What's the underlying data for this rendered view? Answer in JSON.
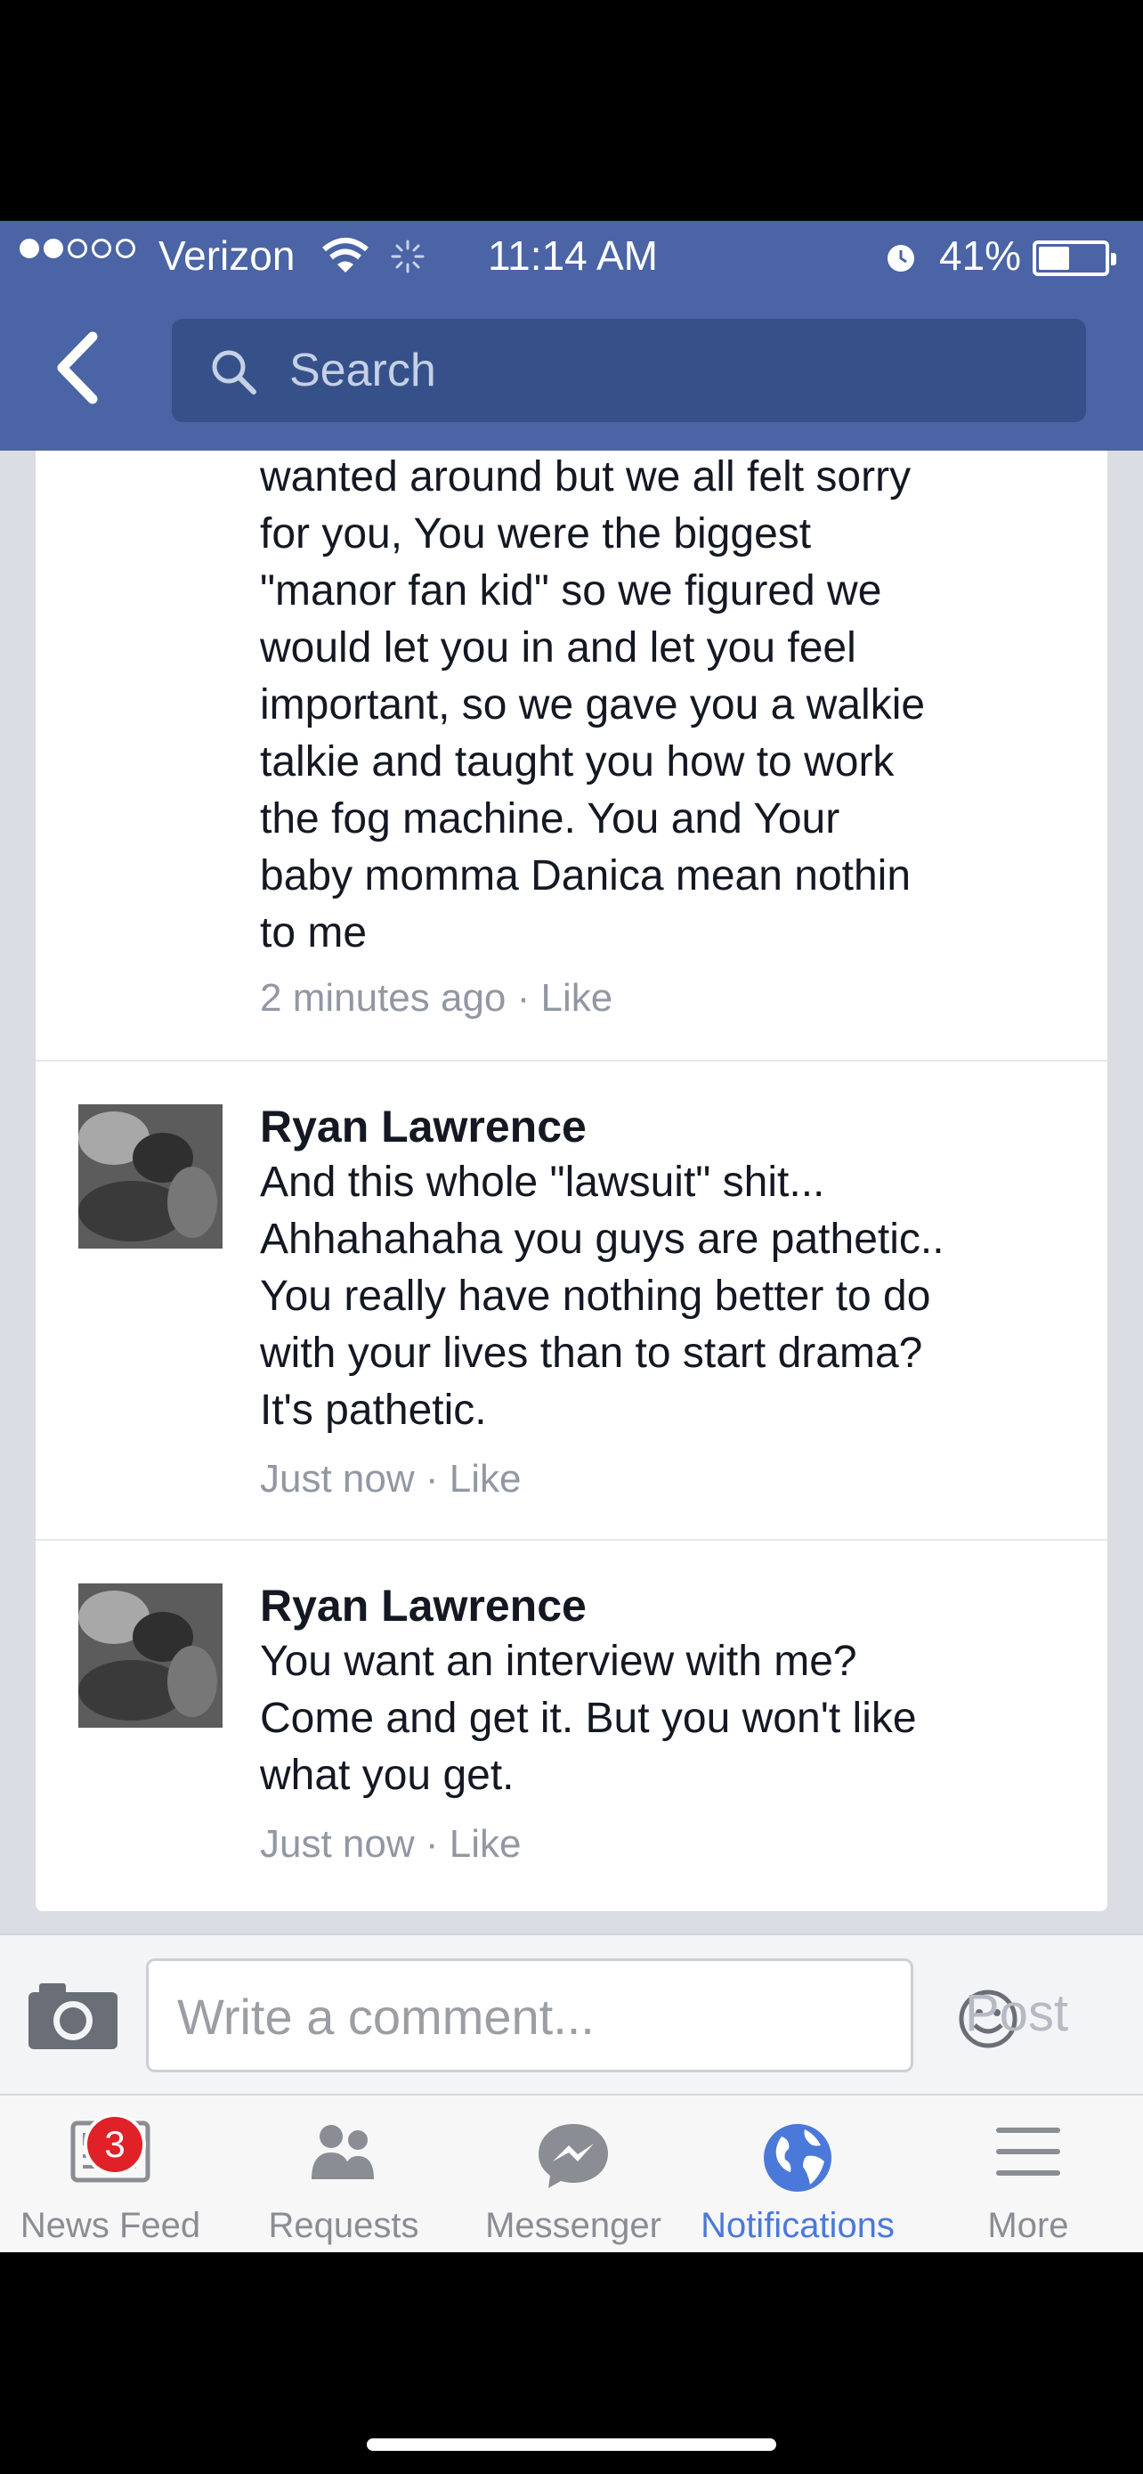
{
  "status_bar": {
    "carrier": "Verizon",
    "time": "11:14 AM",
    "battery": "41%",
    "signal_bars_filled": 2,
    "signal_bars_total": 5
  },
  "nav": {
    "search_placeholder": "Search"
  },
  "comments": [
    {
      "author": "",
      "lines": [
        "wanted around but we all felt sorry",
        "for you, You were the biggest",
        "\"manor fan kid\" so we figured we",
        "would let you in and let you feel",
        "important, so we gave you a walkie",
        "talkie and taught you how to work",
        "the fog machine. You and Your",
        "baby momma Danica mean nothin",
        "to me"
      ],
      "time": "2 minutes ago",
      "like_label": "Like"
    },
    {
      "author": "Ryan Lawrence",
      "lines": [
        "And this whole \"lawsuit\" shit...",
        "Ahhahahaha you guys are pathetic..",
        "You really have nothing better to do",
        "with your lives than to start drama?",
        "It's pathetic."
      ],
      "time": "Just now",
      "like_label": "Like"
    },
    {
      "author": "Ryan Lawrence",
      "lines": [
        "You want an interview with me?",
        "Come and get it. But you won't like",
        "what you get."
      ],
      "time": "Just now",
      "like_label": "Like"
    }
  ],
  "composer": {
    "placeholder": "Write a comment...",
    "post_label": "Post"
  },
  "tabs": [
    {
      "label": "News Feed",
      "icon": "news-feed-icon",
      "badge": "3"
    },
    {
      "label": "Requests",
      "icon": "requests-icon"
    },
    {
      "label": "Messenger",
      "icon": "messenger-icon"
    },
    {
      "label": "Notifications",
      "icon": "globe-icon",
      "active": true
    },
    {
      "label": "More",
      "icon": "menu-icon"
    }
  ],
  "colors": {
    "header_blue": "#4a64a5",
    "active_tab": "#4a79d9",
    "badge_red": "#e02228"
  }
}
